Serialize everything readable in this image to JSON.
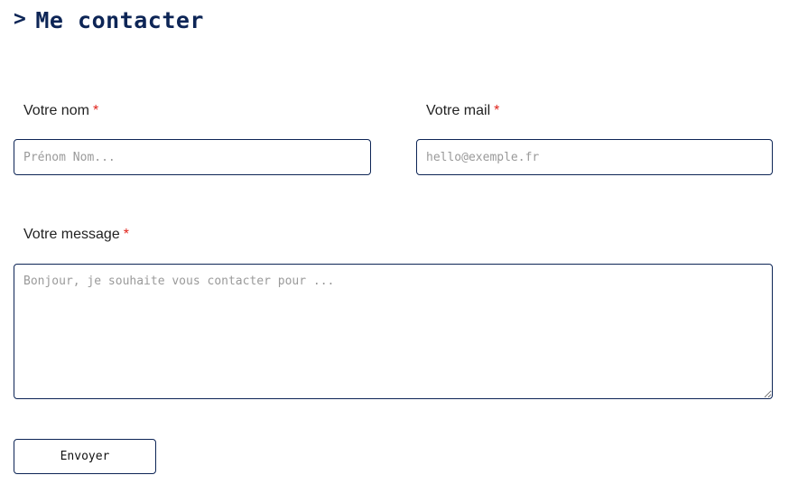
{
  "page": {
    "title": "Me contacter",
    "title_prefix": ">"
  },
  "form": {
    "required_mark": "*",
    "name": {
      "label": "Votre nom",
      "placeholder": "Prénom Nom...",
      "value": ""
    },
    "email": {
      "label": "Votre mail",
      "placeholder": "hello@exemple.fr",
      "value": ""
    },
    "message": {
      "label": "Votre message",
      "placeholder": "Bonjour, je souhaite vous contacter pour ...",
      "value": ""
    },
    "submit_label": "Envoyer"
  },
  "colors": {
    "accent": "#0d2556",
    "required": "#e0231b",
    "placeholder": "#9a9a9a"
  }
}
